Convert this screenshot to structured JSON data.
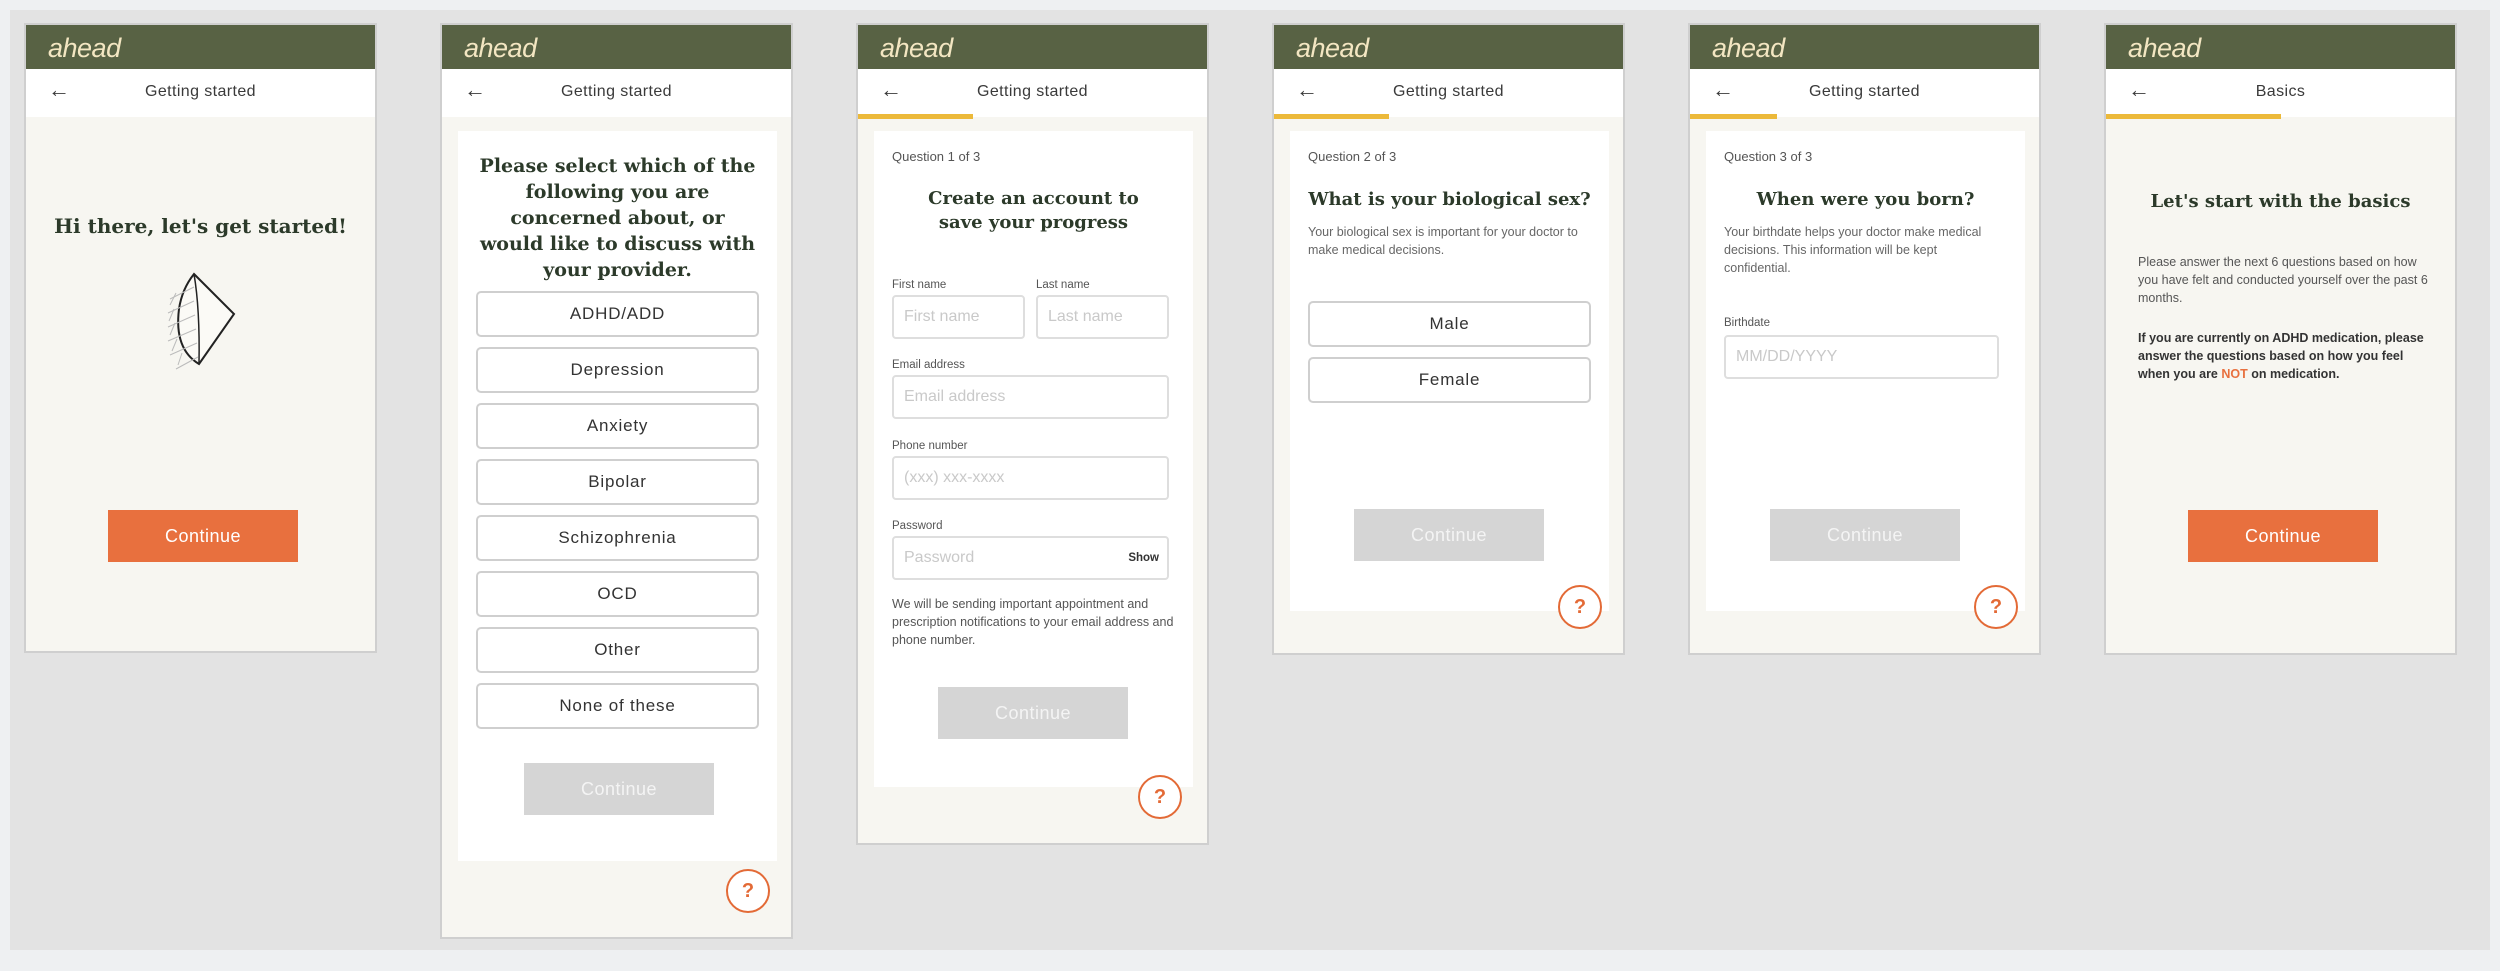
{
  "brand": {
    "logo": "ahead",
    "colors": {
      "header": "#586244",
      "accent": "#e8703e",
      "progress": "#ecb93a"
    }
  },
  "icons": {
    "back": "back-arrow-icon",
    "help": "question-mark-icon"
  },
  "screens": [
    {
      "nav_title": "Getting started",
      "title": "Hi there, let's get started!",
      "illustration": "leaf-folded-illustration",
      "continue": "Continue"
    },
    {
      "nav_title": "Getting started",
      "title": "Please select which of the following you are concerned about, or would like to discuss with your provider.",
      "options": [
        "ADHD/ADD",
        "Depression",
        "Anxiety",
        "Bipolar",
        "Schizophrenia",
        "OCD",
        "Other",
        "None of these"
      ],
      "continue": "Continue",
      "help": "?"
    },
    {
      "nav_title": "Getting started",
      "progress": 0.33,
      "question": "Question 1 of 3",
      "title": "Create an account to save your progress",
      "fields": {
        "first_name_label": "First name",
        "first_name_placeholder": "First name",
        "last_name_label": "Last name",
        "last_name_placeholder": "Last name",
        "email_label": "Email address",
        "email_placeholder": "Email address",
        "phone_label": "Phone number",
        "phone_placeholder": "(xxx) xxx-xxxx",
        "password_label": "Password",
        "password_placeholder": "Password",
        "show": "Show"
      },
      "note": "We will be sending important appointment and prescription notifications to your email address and phone number.",
      "continue": "Continue",
      "help": "?"
    },
    {
      "nav_title": "Getting started",
      "progress": 0.33,
      "question": "Question 2 of 3",
      "title": "What is your biological sex?",
      "subtext": "Your biological sex is important for your doctor to make medical decisions.",
      "options": [
        "Male",
        "Female"
      ],
      "continue": "Continue",
      "help": "?"
    },
    {
      "nav_title": "Getting started",
      "progress": 0.33,
      "question": "Question 3 of 3",
      "title": "When were you born?",
      "subtext": "Your birthdate helps your doctor make medical decisions. This information will be kept confidential.",
      "birthdate_label": "Birthdate",
      "birthdate_placeholder": "MM/DD/YYYY",
      "continue": "Continue",
      "help": "?"
    },
    {
      "nav_title": "Basics",
      "progress": 0.67,
      "title": "Let's start with the basics",
      "para1": "Please answer the next 6 questions based on how you have felt and conducted yourself over the past 6 months.",
      "para2_before": "If you are currently on ADHD medication, please answer the questions based on how you feel when you are ",
      "para2_highlight": "NOT",
      "para2_after": " on medication.",
      "continue": "Continue"
    }
  ]
}
